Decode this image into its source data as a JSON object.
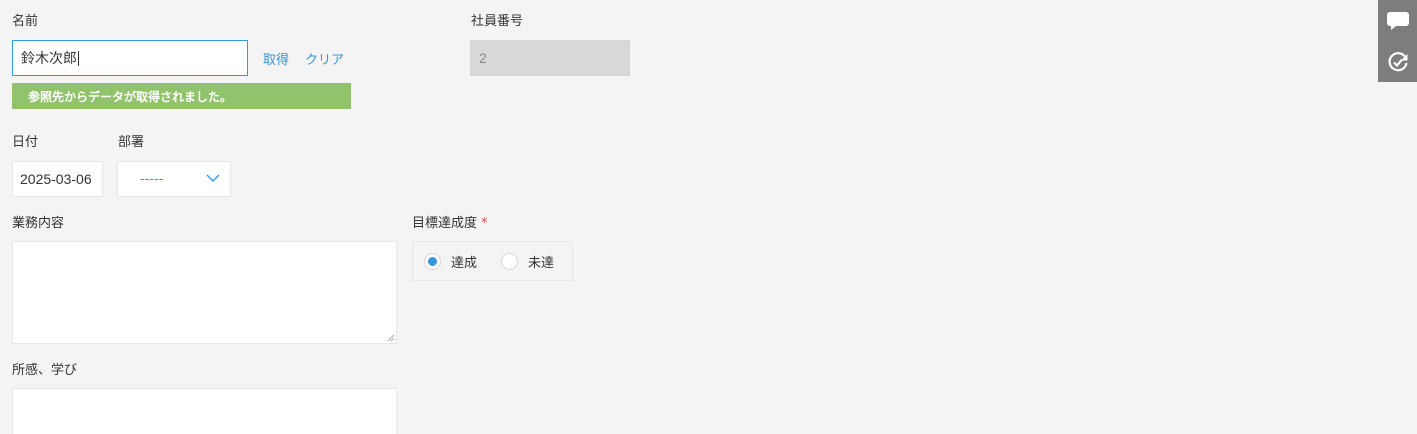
{
  "form": {
    "name_field": {
      "label": "名前",
      "value": "鈴木次郎"
    },
    "lookup_actions": {
      "fetch": "取得",
      "clear": "クリア"
    },
    "lookup_notice": "参照先からデータが取得されました。",
    "employee_number": {
      "label": "社員番号",
      "value": "2"
    },
    "date_field": {
      "label": "日付",
      "value": "2025-03-06"
    },
    "department_field": {
      "label": "部署",
      "selected": "-----"
    },
    "work_content": {
      "label": "業務内容",
      "value": ""
    },
    "goal_achievement": {
      "label": "目標達成度",
      "required_mark": "*",
      "options": [
        {
          "label": "達成",
          "checked": true
        },
        {
          "label": "未達",
          "checked": false
        }
      ]
    },
    "impressions": {
      "label": "所感、学び",
      "value": ""
    }
  },
  "sidebar": {
    "icons": [
      "comment-icon",
      "history-icon"
    ]
  },
  "colors": {
    "accent": "#3498db",
    "notice_bg": "#91c36c",
    "sidebar_bg": "#7d7d7d",
    "page_bg": "#f4f4f4"
  }
}
